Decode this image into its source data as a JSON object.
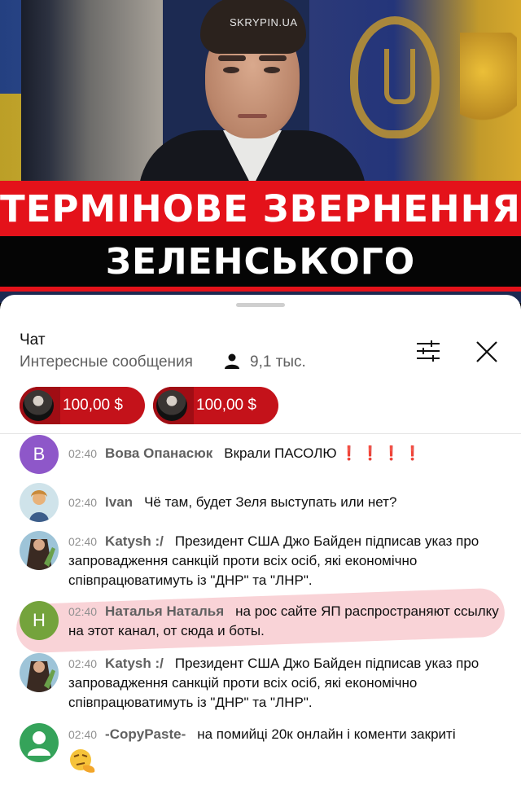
{
  "video": {
    "watermark": "SKRYPIN.UA",
    "title_line1": "ТЕРМІНОВЕ ЗВЕРНЕННЯ",
    "title_line2": "ЗЕЛЕНСЬКОГО"
  },
  "chat": {
    "title": "Чат",
    "mode": "Интересные сообщения",
    "viewers": "9,1 тыс.",
    "filter_icon": "filter-sliders-icon",
    "close_icon": "close-icon",
    "super_chats": [
      {
        "amount": "100,00 $"
      },
      {
        "amount": "100,00 $"
      }
    ],
    "messages": [
      {
        "time": "02:40",
        "author": "Вова Опанасюк",
        "text": "Вкрали ПАСОЛЮ",
        "suffix": "❗ ❗ ❗ ❗",
        "avatar_letter": "B",
        "avatar_color": "#8e57c9"
      },
      {
        "time": "02:40",
        "author": "Ivan",
        "text": "Чё там, будет Зеля выступать или нет?"
      },
      {
        "time": "02:40",
        "author": "Katysh :/",
        "text": "Президент США Джо Байден підписав указ про запровадження санкцій проти всіх осіб, які економічно співпрацюватимуть із \"ДНР\" та \"ЛНР\"."
      },
      {
        "time": "02:40",
        "author": "Наталья Наталья",
        "text": "на рос сайте ЯП распространяют ссылку на этот канал, от сюда и боты.",
        "avatar_letter": "H",
        "avatar_color": "#74a33c"
      },
      {
        "time": "02:40",
        "author": "Katysh :/",
        "text": "Президент США Джо Байден підписав указ про запровадження санкцій проти всіх осіб, які економічно співпрацюватимуть із \"ДНР\" та \"ЛНР\"."
      },
      {
        "time": "02:40",
        "author": "-CopyPaste-",
        "text": "на помийці 20к онлайн і коменти закриті"
      }
    ]
  },
  "colors": {
    "accent_red": "#e4121a",
    "superchat_red": "#c4121a"
  }
}
